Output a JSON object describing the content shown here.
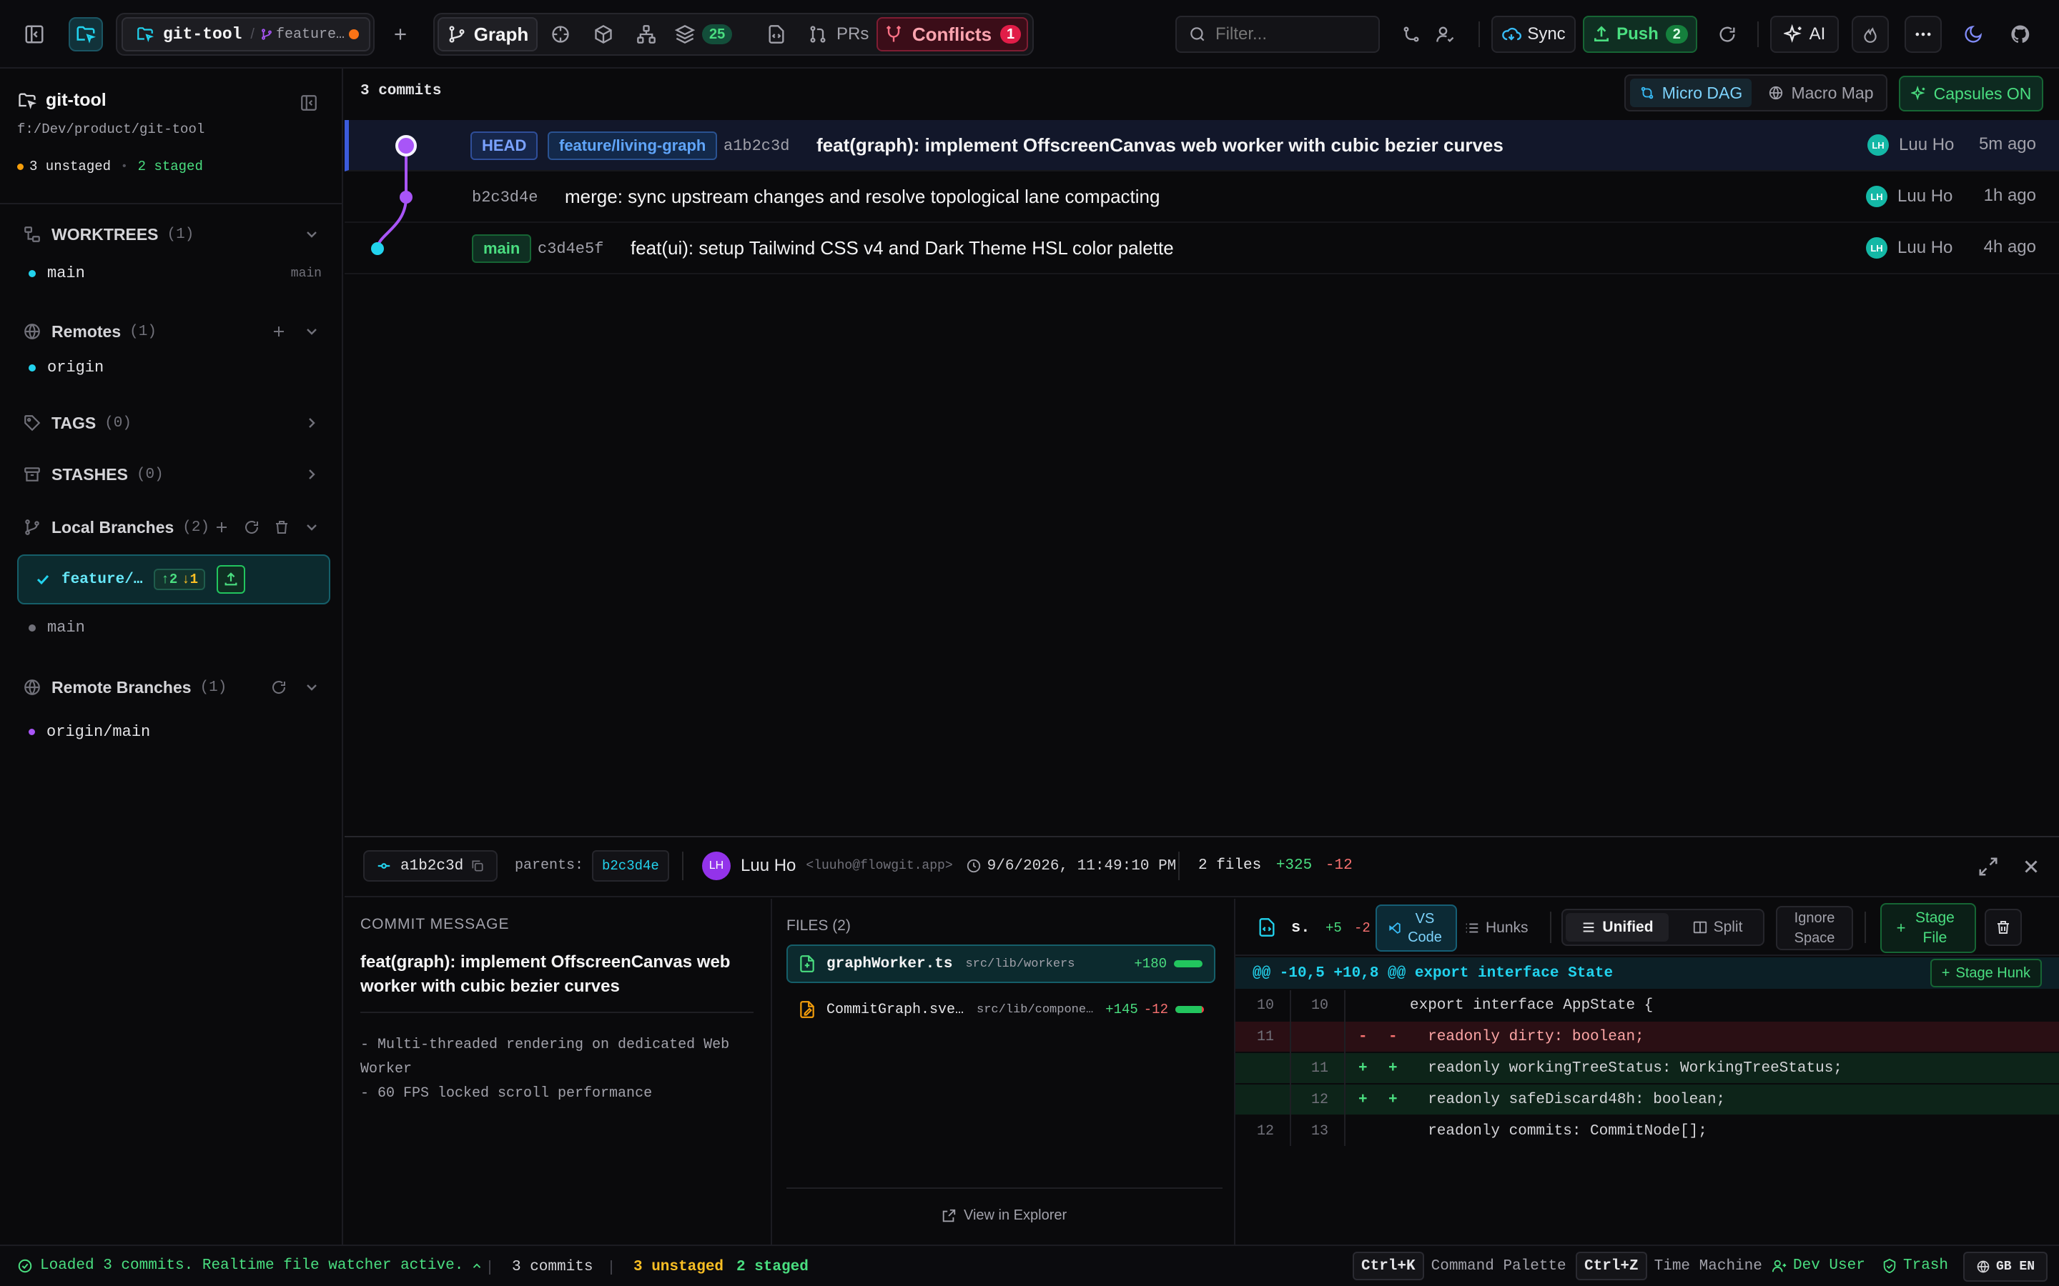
{
  "toolbar": {
    "repo_name": "git-tool",
    "branch_short": "feature…",
    "views": {
      "graph": "Graph",
      "stack_count": "25",
      "prs": "PRs",
      "conflicts": "Conflicts",
      "conflicts_count": "1"
    },
    "filter_placeholder": "Filter...",
    "sync": "Sync",
    "push": "Push",
    "push_count": "2",
    "ai": "AI"
  },
  "sidebar": {
    "repo_title": "git-tool",
    "repo_path": "f:/Dev/product/git-tool",
    "unstaged": "3 unstaged",
    "staged": "2 staged",
    "worktrees": {
      "title": "WORKTREES",
      "count": "(1)",
      "items": [
        {
          "name": "main",
          "branch": "main"
        }
      ]
    },
    "remotes": {
      "title": "Remotes",
      "count": "(1)",
      "items": [
        {
          "name": "origin"
        }
      ]
    },
    "tags": {
      "title": "TAGS",
      "count": "(0)"
    },
    "stashes": {
      "title": "STASHES",
      "count": "(0)"
    },
    "local_branches": {
      "title": "Local Branches",
      "count": "(2)",
      "active": {
        "name": "feature/…",
        "ahead": "↑2",
        "behind": "↓1"
      },
      "items": [
        {
          "name": "main"
        }
      ]
    },
    "remote_branches": {
      "title": "Remote Branches",
      "count": "(1)",
      "items": [
        {
          "name": "origin/main"
        }
      ]
    }
  },
  "graph": {
    "commit_count": "3 commits",
    "micro_dag": "Micro DAG",
    "macro_map": "Macro Map",
    "capsules": "Capsules ON",
    "commits": [
      {
        "badges": [
          "HEAD",
          "feature/living-graph"
        ],
        "hash": "a1b2c3d",
        "message": "feat(graph): implement OffscreenCanvas web worker with cubic bezier curves",
        "author_initials": "LH",
        "author": "Luu Ho",
        "time": "5m ago"
      },
      {
        "badges": [],
        "hash": "b2c3d4e",
        "message": "merge: sync upstream changes and resolve topological lane compacting",
        "author_initials": "LH",
        "author": "Luu Ho",
        "time": "1h ago"
      },
      {
        "badges": [
          "main"
        ],
        "hash": "c3d4e5f",
        "message": "feat(ui): setup Tailwind CSS v4 and Dark Theme HSL color palette",
        "author_initials": "LH",
        "author": "Luu Ho",
        "time": "4h ago"
      }
    ]
  },
  "details": {
    "sha": "a1b2c3d",
    "parents_label": "parents:",
    "parent_sha": "b2c3d4e",
    "author_initials": "LH",
    "author": "Luu Ho",
    "email": "<luuho@flowgit.app>",
    "date": "9/6/2026, 11:49:10 PM",
    "files_summary": "2 files",
    "additions": "+325",
    "deletions": "-12",
    "commit_message_label": "COMMIT MESSAGE",
    "commit_subject": "feat(graph): implement OffscreenCanvas web worker with cubic bezier curves",
    "commit_body": [
      "- Multi-threaded rendering on dedicated Web Worker",
      "- 60 FPS locked scroll performance"
    ],
    "files_label": "FILES (2)",
    "files": [
      {
        "name": "graphWorker.ts",
        "path": "src/lib/workers",
        "add": "+180",
        "del": "",
        "add_ratio": 1.0
      },
      {
        "name": "CommitGraph.sve…",
        "path": "src/lib/compone…",
        "add": "+145",
        "del": "-12",
        "add_ratio": 0.92
      }
    ],
    "view_in_explorer": "View in Explorer"
  },
  "diff": {
    "file_short": "s.",
    "add": "+5",
    "del": "-2",
    "vscode": "VS Code",
    "hunks": "Hunks",
    "unified": "Unified",
    "split": "Split",
    "ignore_space": "Ignore Space",
    "stage_file": "Stage File",
    "hunk_header": "@@ -10,5 +10,8 @@ export interface State",
    "stage_hunk": "Stage Hunk",
    "lines": [
      {
        "old": "10",
        "new": "10",
        "m1": "",
        "m2": "",
        "text": "export interface AppState {",
        "type": "ctx"
      },
      {
        "old": "11",
        "new": "",
        "m1": "-",
        "m2": "-",
        "text": "  readonly dirty: boolean;",
        "type": "del"
      },
      {
        "old": "",
        "new": "11",
        "m1": "+",
        "m2": "+",
        "text": "  readonly workingTreeStatus: WorkingTreeStatus;",
        "type": "add"
      },
      {
        "old": "",
        "new": "12",
        "m1": "+",
        "m2": "+",
        "text": "  readonly safeDiscard48h: boolean;",
        "type": "add"
      },
      {
        "old": "12",
        "new": "13",
        "m1": "",
        "m2": "",
        "text": "  readonly commits: CommitNode[];",
        "type": "ctx"
      }
    ]
  },
  "status": {
    "message": "Loaded 3 commits. Realtime file watcher active.",
    "commits": "3 commits",
    "unstaged": "3 unstaged",
    "staged": "2 staged",
    "cmd_key": "Ctrl+K",
    "cmd_label": "Command Palette",
    "undo_key": "Ctrl+Z",
    "undo_label": "Time Machine",
    "dev_user": "Dev User",
    "trash": "Trash",
    "lang": "GB EN"
  },
  "colors": {
    "accent_cyan": "#22d3ee",
    "accent_purple": "#a855f7",
    "push_green": "#22c55e",
    "conflict_red": "#f43f5e",
    "teal": "#14b8a6"
  }
}
